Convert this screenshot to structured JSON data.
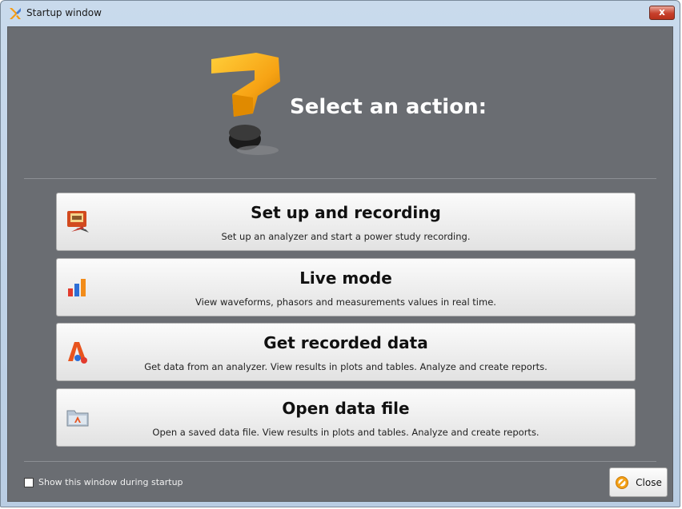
{
  "window": {
    "title": "Startup window",
    "close_glyph": "x"
  },
  "hero": {
    "headline": "Select an action:"
  },
  "actions": [
    {
      "title": "Set up and recording",
      "description": "Set up an analyzer and start a power study recording.",
      "icon": "setup-recording-icon"
    },
    {
      "title": "Live mode",
      "description": "View waveforms, phasors and measurements values in real time.",
      "icon": "live-mode-icon"
    },
    {
      "title": "Get recorded data",
      "description": "Get data from an analyzer. View results in plots and tables. Analyze and create reports.",
      "icon": "recorded-data-icon"
    },
    {
      "title": "Open data file",
      "description": "Open a saved data file. View results in plots and tables. Analyze and create reports.",
      "icon": "open-file-icon"
    }
  ],
  "footer": {
    "startup_label": "Show this window during startup",
    "startup_checked": false,
    "close_label": "Close"
  }
}
